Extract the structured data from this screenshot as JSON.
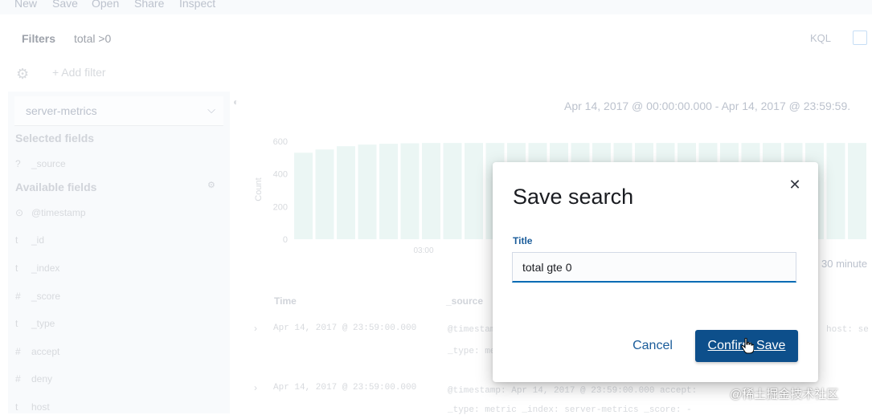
{
  "topnav": {
    "items": [
      "New",
      "Save",
      "Open",
      "Share",
      "Inspect"
    ]
  },
  "filterbar": {
    "label": "Filters",
    "query": "total >0",
    "language": "KQL",
    "add_filter": "+ Add filter",
    "icons": [
      "gear-icon",
      "calendar-icon"
    ]
  },
  "sidebar": {
    "index_pattern": "server-metrics",
    "selected_title": "Selected fields",
    "selected_fields": [
      {
        "type": "?",
        "name": "_source"
      }
    ],
    "available_title": "Available fields",
    "available_fields": [
      {
        "type": "⊙",
        "name": "@timestamp"
      },
      {
        "type": "t",
        "name": "_id"
      },
      {
        "type": "t",
        "name": "_index"
      },
      {
        "type": "#",
        "name": "_score"
      },
      {
        "type": "t",
        "name": "_type"
      },
      {
        "type": "#",
        "name": "accept"
      },
      {
        "type": "#",
        "name": "deny"
      },
      {
        "type": "t",
        "name": "host"
      }
    ]
  },
  "main": {
    "date_range": "Apr 14, 2017 @ 00:00:00.000 - Apr 14, 2017 @ 23:59:59.",
    "interval_label": "30 minute",
    "columns": [
      "Time",
      "_source"
    ],
    "rows": [
      {
        "time": "Apr 14, 2017 @ 23:59:00.000",
        "source_line1": "@timestamp: Apr 14, 2017 @ 23:59:00.000  accept:",
        "source_line2": "_type: metric  _index: server-metrics  _score: -",
        "host_fragment": "host: se"
      },
      {
        "time": "Apr 14, 2017 @ 23:59:00.000",
        "source_line1": "@timestamp: Apr 14, 2017 @ 23:59:00.000  accept:",
        "source_line2": "_type: metric  _index: server-metrics  _score: -",
        "host_fragment": ""
      }
    ]
  },
  "chart_data": {
    "type": "bar",
    "ylabel": "Count",
    "yticks": [
      0,
      200,
      400,
      600
    ],
    "ylim": [
      0,
      620
    ],
    "xtick_labels": [
      "03:00"
    ],
    "values": [
      530,
      550,
      570,
      580,
      585,
      588,
      590,
      590,
      590,
      590,
      590,
      590,
      590,
      590,
      590,
      590,
      590,
      590,
      590,
      590,
      590,
      590,
      590,
      590,
      590,
      590,
      590,
      590
    ],
    "color": "#e0f2ef"
  },
  "modal": {
    "title": "Save search",
    "field_label": "Title",
    "field_value": "total gte 0",
    "cancel_label": "Cancel",
    "confirm_label": "Confirm Save"
  },
  "watermark": "@稀土掘金技术社区"
}
